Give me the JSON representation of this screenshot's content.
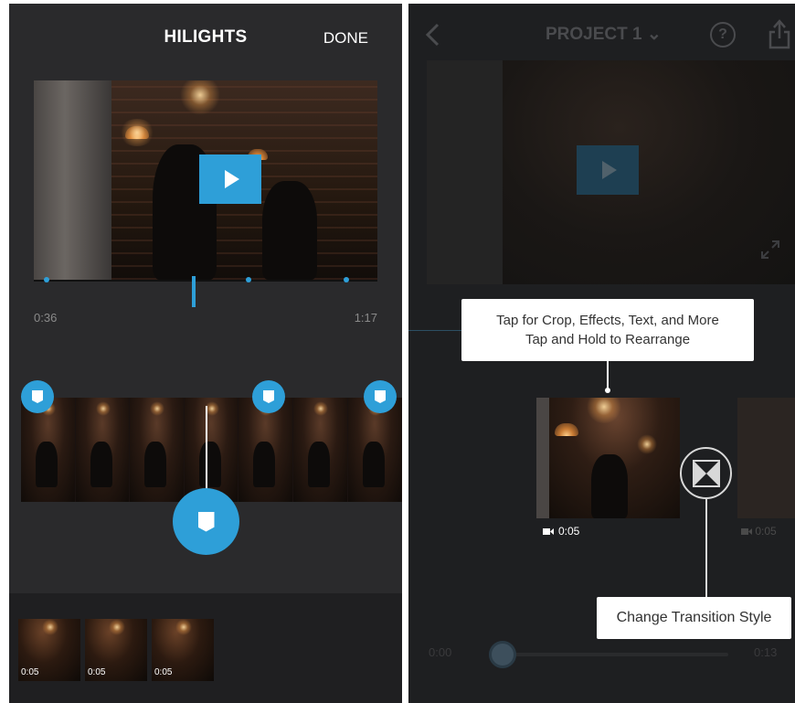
{
  "left": {
    "title": "HILIGHTS",
    "done_label": "DONE",
    "time_start": "0:36",
    "time_end": "1:17",
    "clips": [
      {
        "duration": "0:05"
      },
      {
        "duration": "0:05"
      },
      {
        "duration": "0:05"
      }
    ]
  },
  "right": {
    "project_title": "PROJECT 1",
    "project_caret": "⌄",
    "help_glyph": "?",
    "tooltip_top_line1": "Tap for Crop, Effects, Text, and More",
    "tooltip_top_line2": "Tap and Hold to Rearrange",
    "tooltip_bottom": "Change Transition Style",
    "clip_duration": "0:05",
    "next_clip_duration": "0:05",
    "time_start": "0:00",
    "time_end": "0:13"
  },
  "colors": {
    "accent": "#2e9fd8",
    "left_bg": "#2a2a2c",
    "right_bg": "#1e1f21"
  },
  "icons": [
    "play-icon",
    "highlight-tag-icon",
    "back-chevron-icon",
    "help-icon",
    "share-icon",
    "expand-icon",
    "camera-icon",
    "transition-icon"
  ]
}
